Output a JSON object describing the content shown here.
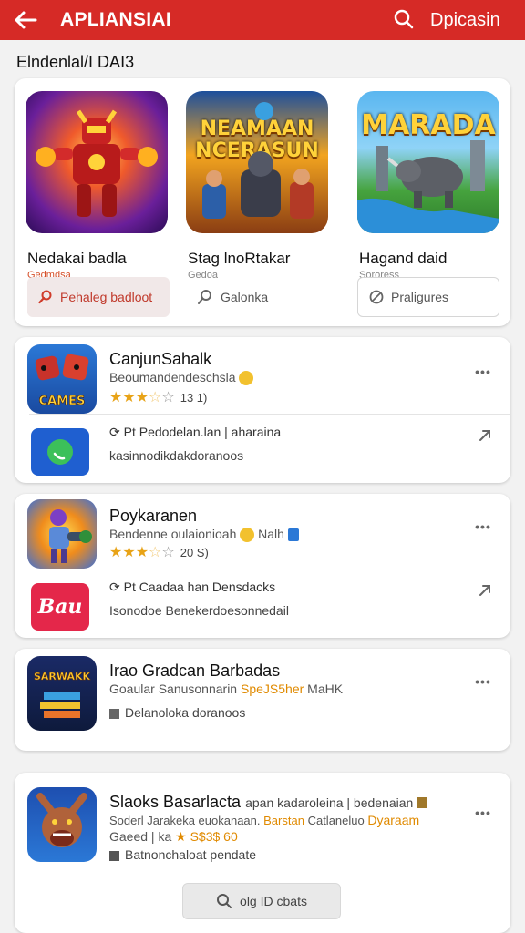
{
  "header": {
    "back_icon": "arrow-left-icon",
    "title": "APLIANSIAI",
    "search_icon": "search-icon",
    "action_label": "Dpicasin",
    "bar_color": "#d62a26"
  },
  "section_title": "Elndenlal/I DAI3",
  "featured": [
    {
      "art_text": "",
      "name": "Nedakai badla",
      "sub": "Gedmdsa",
      "sub_color": "#d6502a",
      "button": "Pehaleg badloot",
      "button_icon": "pin-icon"
    },
    {
      "art_text": "NEAMAAN NCERASUN",
      "name": "Stag lnoRtakar",
      "sub": "Gedoa",
      "sub_color": "#888888",
      "button": "Galonka",
      "button_icon": "search-icon"
    },
    {
      "art_text": "MARADA",
      "name": "Hagand daid",
      "sub": "Sororess",
      "sub_color": "#888888",
      "button": "Praligures",
      "button_icon": "no-icon"
    }
  ],
  "apps": [
    {
      "icon_text": "CAMES",
      "name": "CanjunSahalk",
      "desc": "Beoumandendeschsla",
      "desc_orange": "",
      "desc_after": "",
      "stars_on": "★★★",
      "stars_half": "☆",
      "stars_off": "☆",
      "rating": "13 1)",
      "sub_icon": "whatsapp-icon",
      "sub_line1": "Pt Pedodelan.lan | aharaina",
      "sub_line2": "kasinnodikdakdoranoos"
    },
    {
      "icon_text": "",
      "name": "Poykaranen",
      "desc": "Bendenne oulaionioah",
      "desc_orange": "",
      "desc_after": "Nalh",
      "stars_on": "★★★",
      "stars_half": "☆",
      "stars_off": "☆",
      "rating": "20 S)",
      "sub_icon": "brand-icon",
      "sub_icon_text": "Bau",
      "sub_line1": "Pt Caadaa han Densdacks",
      "sub_line2": "Isonodoe Benekerdoesonnedail"
    },
    {
      "icon_text": "SARWAKK",
      "name": "Irao Gradcan Barbadas",
      "desc": "Goaular Sanusonnarin",
      "desc_orange": "SpeJS5her",
      "desc_after": "MaHK",
      "sub_line1": "Delanoloka doranoos"
    },
    {
      "icon_text": "",
      "name": "Slaoks Basarlacta",
      "name_after": "apan kadaroleina | bedenaian",
      "desc": "Soderl Jarakeka euokanaan.",
      "desc_orange": "Barstan",
      "desc_after": "Catlaneluo",
      "desc_orange2": "Dyaraam",
      "line2_pre": "Gaeed | ka",
      "rating_orange": "★ S$3$ 60",
      "sub_line1": "Batnonchaloat pendate"
    }
  ],
  "load_more": "olg ID cbats"
}
